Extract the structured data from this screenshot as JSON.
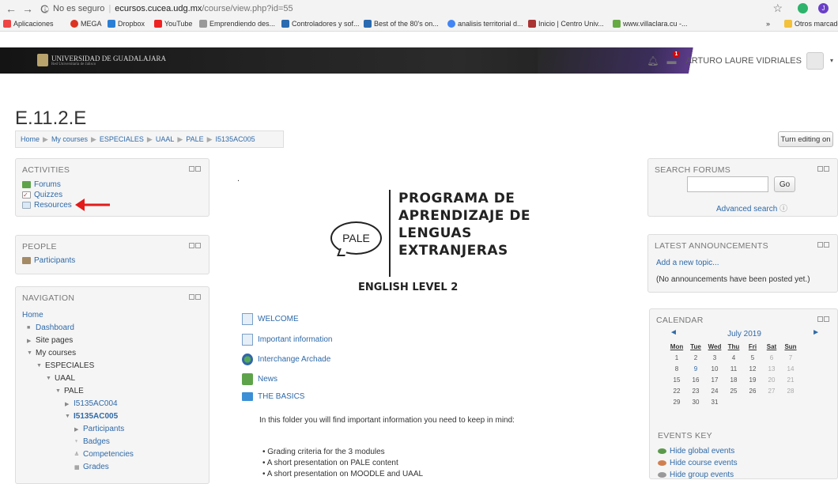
{
  "browser": {
    "security": "No es seguro",
    "host": "ecursos.cucea.udg.mx",
    "path": "/course/view.php?id=55",
    "bookmarks": [
      {
        "label": "Aplicaciones",
        "color": "#e44"
      },
      {
        "label": "MEGA",
        "color": "#d32"
      },
      {
        "label": "Dropbox",
        "color": "#2a7fd4"
      },
      {
        "label": "YouTube",
        "color": "#e22"
      },
      {
        "label": "Emprendiendo des...",
        "color": "#999"
      },
      {
        "label": "Controladores y sof...",
        "color": "#2a6ab0"
      },
      {
        "label": "Best of the 80's on...",
        "color": "#2a6ab0"
      },
      {
        "label": "analisis territorial d...",
        "color": "#4285f4"
      },
      {
        "label": "Inicio | Centro Univ...",
        "color": "#a33"
      },
      {
        "label": "www.villaclara.cu -...",
        "color": "#6a4"
      }
    ],
    "more": "»",
    "other_bookmarks": "Otros marcadores"
  },
  "header": {
    "university": "UNIVERSIDAD DE GUADALAJARA",
    "university_sub": "Red Universitaria de Jalisco",
    "notif_count": "1",
    "user": "ARTURO LAURE VIDRIALES"
  },
  "page": {
    "title": "E.11.2.E",
    "breadcrumb": [
      "Home",
      "My courses",
      "ESPECIALES",
      "UAAL",
      "PALE",
      "I5135AC005"
    ],
    "edit_button": "Turn editing on"
  },
  "activities": {
    "title": "ACTIVITIES",
    "items": [
      "Forums",
      "Quizzes",
      "Resources"
    ]
  },
  "people": {
    "title": "PEOPLE",
    "items": [
      "Participants"
    ]
  },
  "navigation": {
    "title": "NAVIGATION",
    "items": [
      "Home",
      "Dashboard",
      "Site pages",
      "My courses",
      "ESPECIALES",
      "UAAL",
      "PALE",
      "I5135AC004",
      "I5135AC005",
      "Participants",
      "Badges",
      "Competencies",
      "Grades"
    ]
  },
  "center": {
    "dot": ".",
    "logo_text": "PALE",
    "program_title": "PROGRAMA DE\nAPRENDIZAJE DE\nLENGUAS\nEXTRANJERAS",
    "level": "ENGLISH LEVEL 2",
    "activities": [
      "WELCOME",
      "Important information",
      "Interchange Archade",
      "News",
      "THE BASICS"
    ],
    "folder_desc": "In this folder you will find important information you need to keep in mind:",
    "bullets": [
      "Grading criteria for the 3 modules",
      "A short presentation on PALE content",
      "A short presentation on MOODLE and UAAL"
    ]
  },
  "search": {
    "title": "SEARCH FORUMS",
    "go": "Go",
    "advanced": "Advanced search"
  },
  "announcements": {
    "title": "LATEST ANNOUNCEMENTS",
    "add": "Add a new topic...",
    "none": "(No announcements have been posted yet.)"
  },
  "calendar": {
    "title": "CALENDAR",
    "month": "July 2019",
    "days": [
      "Mon",
      "Tue",
      "Wed",
      "Thu",
      "Fri",
      "Sat",
      "Sun"
    ],
    "weeks": [
      [
        "1",
        "2",
        "3",
        "4",
        "5",
        "6",
        "7"
      ],
      [
        "8",
        "9",
        "10",
        "11",
        "12",
        "13",
        "14"
      ],
      [
        "15",
        "16",
        "17",
        "18",
        "19",
        "20",
        "21"
      ],
      [
        "22",
        "23",
        "24",
        "25",
        "26",
        "27",
        "28"
      ],
      [
        "29",
        "30",
        "31",
        "",
        "",
        "",
        ""
      ]
    ],
    "events_key": "EVENTS KEY",
    "events": [
      "Hide global events",
      "Hide course events",
      "Hide group events"
    ]
  }
}
